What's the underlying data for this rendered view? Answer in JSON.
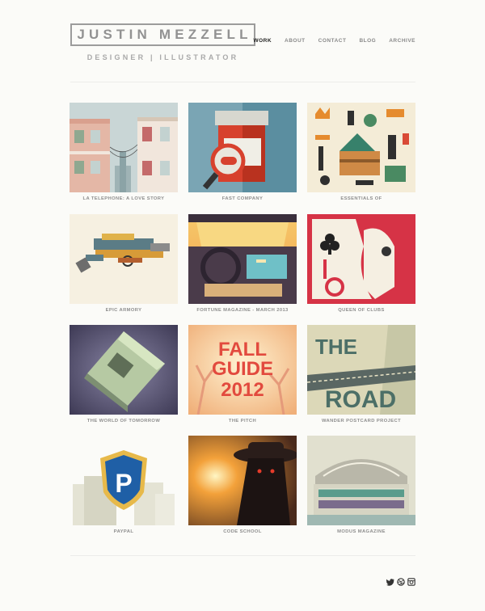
{
  "brand": {
    "name": "JUSTIN MEZZELL",
    "tagline": "DESIGNER | ILLUSTRATOR"
  },
  "nav": {
    "work": "WORK",
    "about": "ABOUT",
    "contact": "CONTACT",
    "blog": "BLOG",
    "archive": "ARCHIVE",
    "active": "work"
  },
  "portfolio": [
    {
      "caption": "LA TELEPHONE: A LOVE STORY"
    },
    {
      "caption": "FAST COMPANY"
    },
    {
      "caption": "ESSENTIALS OF"
    },
    {
      "caption": "EPIC ARMORY"
    },
    {
      "caption": "FORTUNE MAGAZINE - MARCH 2013"
    },
    {
      "caption": "QUEEN OF CLUBS"
    },
    {
      "caption": "THE WORLD OF TOMORROW"
    },
    {
      "caption": "THE PITCH"
    },
    {
      "caption": "WANDER POSTCARD PROJECT"
    },
    {
      "caption": "PAYPAL"
    },
    {
      "caption": "CODE SCHOOL"
    },
    {
      "caption": "MODUS MAGAZINE"
    }
  ],
  "artwork_text": {
    "pitch_line1": "FALL",
    "pitch_line2": "GUIDE",
    "pitch_line3": "2012",
    "wander_line1": "THE",
    "wander_line2": "ROAD",
    "paypal_letter": "P"
  },
  "social": [
    "twitter-icon",
    "dribbble-icon",
    "instagram-icon"
  ],
  "colors": {
    "active_nav": "#1f1f1f",
    "nav": "#8a8a8a",
    "caption": "#8e8e8e",
    "logo": "#929292"
  }
}
